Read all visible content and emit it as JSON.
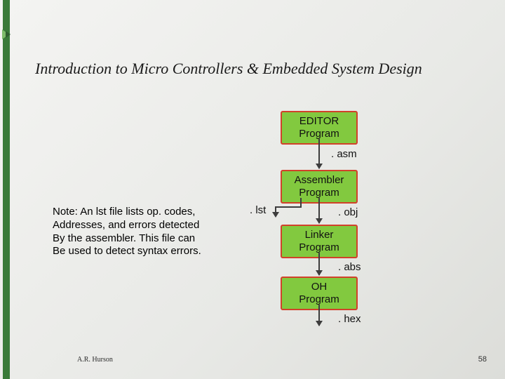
{
  "title": "Introduction to Micro Controllers & Embedded System Design",
  "boxes": {
    "editor": "EDITOR\nProgram",
    "assembler": "Assembler\nProgram",
    "linker": "Linker\nProgram",
    "oh": "OH\nProgram"
  },
  "labels": {
    "asm": ". asm",
    "lst": ". lst",
    "obj": ". obj",
    "abs": ". abs",
    "hex": ". hex"
  },
  "note": "Note:  An lst file lists op. codes,\nAddresses, and errors detected\nBy the assembler.  This file can\nBe used to detect syntax errors.",
  "footer": {
    "author": "A.R. Hurson",
    "page": "58"
  }
}
